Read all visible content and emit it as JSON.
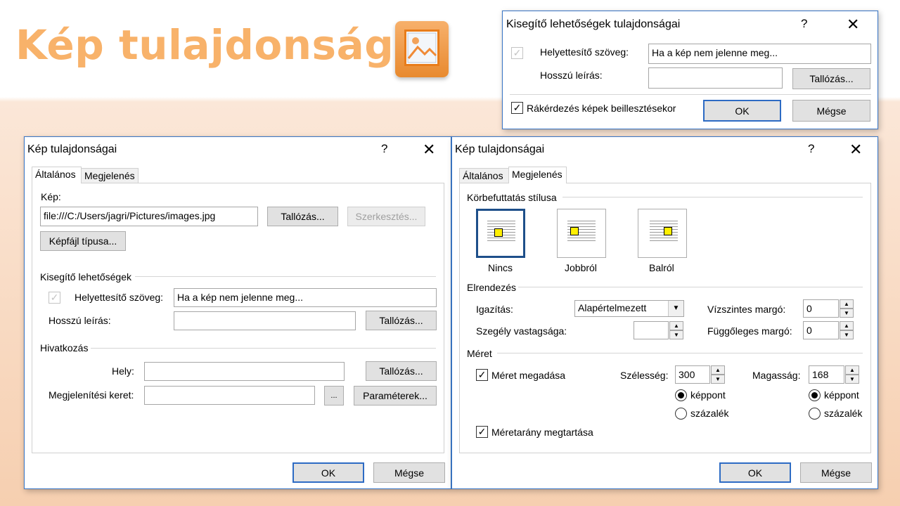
{
  "slide": {
    "title": "Kép tulajdonságai"
  },
  "top_dialog": {
    "title": "Kisegítő lehetőségek tulajdonságai",
    "help": "?",
    "close": "✕",
    "alt_text_label": "Helyettesítő szöveg:",
    "alt_text_value": "Ha a kép nem jelenne meg...",
    "long_desc_label": "Hosszú leírás:",
    "long_desc_value": "",
    "browse": "Tallózás...",
    "prompt_label": "Rákérdezés képek beillesztésekor",
    "ok": "OK",
    "cancel": "Mégse"
  },
  "left_dialog": {
    "title": "Kép tulajdonságai",
    "help": "?",
    "close": "✕",
    "tabs": [
      "Általános",
      "Megjelenés"
    ],
    "image_label": "Kép:",
    "image_path": "file:///C:/Users/jagri/Pictures/images.jpg",
    "browse": "Tallózás...",
    "edit": "Szerkesztés...",
    "file_type": "Képfájl típusa...",
    "accessibility_group": "Kisegítő lehetőségek",
    "alt_text_label": "Helyettesítő szöveg:",
    "alt_text_value": "Ha a kép nem jelenne meg...",
    "long_desc_label": "Hosszú leírás:",
    "long_desc_value": "",
    "browse2": "Tallózás...",
    "link_group": "Hivatkozás",
    "location_label": "Hely:",
    "location_value": "",
    "browse3": "Tallózás...",
    "frame_label": "Megjelenítési keret:",
    "frame_value": "",
    "frame_btn": "...",
    "params": "Paraméterek...",
    "ok": "OK",
    "cancel": "Mégse"
  },
  "right_dialog": {
    "title": "Kép tulajdonságai",
    "help": "?",
    "close": "✕",
    "tabs": [
      "Általános",
      "Megjelenés"
    ],
    "wrap_group": "Körbefuttatás stílusa",
    "wrap_options": [
      "Nincs",
      "Jobbról",
      "Balról"
    ],
    "layout_group": "Elrendezés",
    "align_label": "Igazítás:",
    "align_value": "Alapértelmezett",
    "border_label": "Szegély vastagsága:",
    "border_value": "",
    "hmargin_label": "Vízszintes margó:",
    "hmargin_value": "0",
    "vmargin_label": "Függőleges margó:",
    "vmargin_value": "0",
    "size_group": "Méret",
    "set_size_label": "Méret megadása",
    "width_label": "Szélesség:",
    "width_value": "300",
    "height_label": "Magasság:",
    "height_value": "168",
    "pixels": "képpont",
    "percent": "százalék",
    "keep_ratio_label": "Méretarány megtartása",
    "ok": "OK",
    "cancel": "Mégse"
  }
}
